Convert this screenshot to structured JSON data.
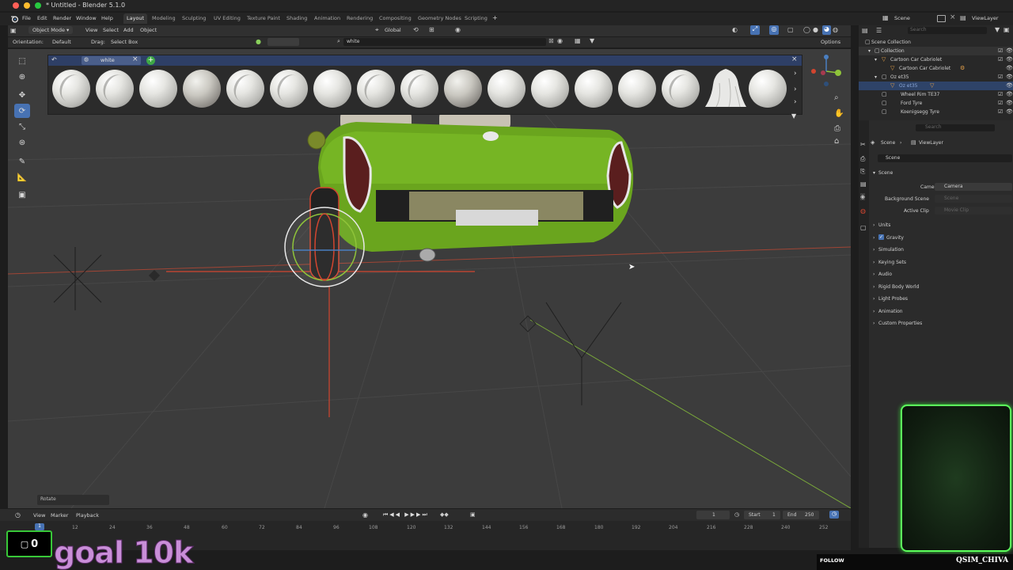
{
  "window": {
    "title": "* Untitled - Blender 5.1.0"
  },
  "menu": {
    "items": [
      "File",
      "Edit",
      "Render",
      "Window",
      "Help"
    ],
    "workspaces": [
      "Layout",
      "Modeling",
      "Sculpting",
      "UV Editing",
      "Texture Paint",
      "Shading",
      "Animation",
      "Rendering",
      "Compositing",
      "Geometry Nodes",
      "Scripting"
    ],
    "active_workspace": "Layout",
    "add_tab": "+",
    "scene_label": "Scene",
    "viewlayer_label": "ViewLayer"
  },
  "viewport_header": {
    "mode": "Object Mode",
    "menus": [
      "View",
      "Select",
      "Add",
      "Object"
    ],
    "transform": "Global"
  },
  "tool_settings": {
    "orientation_label": "Orientation:",
    "orientation_value": "Default",
    "drag_label": "Drag:",
    "drag_value": "Select Box",
    "search_value": "white",
    "options_label": "Options"
  },
  "asset_popup": {
    "tab_label": "white",
    "close": "×",
    "add": "+"
  },
  "last_operator": "Rotate",
  "outliner": {
    "search_placeholder": "Search",
    "rows": [
      {
        "label": "Scene Collection",
        "indent": 0
      },
      {
        "label": "Collection",
        "indent": 1
      },
      {
        "label": "Cartoon Car Cabriolet",
        "indent": 2
      },
      {
        "label": "Cartoon Car Cabriolet",
        "indent": 3
      },
      {
        "label": "Oz et35",
        "indent": 2
      },
      {
        "label": "Oz et35",
        "indent": 3
      },
      {
        "label": "Wheel Rim TE37",
        "indent": 2
      },
      {
        "label": "Ford Tyre",
        "indent": 2
      },
      {
        "label": "Koenigsegg Tyre",
        "indent": 2
      }
    ]
  },
  "properties": {
    "search_placeholder": "Search",
    "breadcrumb": [
      "Scene",
      "ViewLayer"
    ],
    "data_block": "Scene",
    "panel_scene": "Scene",
    "camera_label": "Camera",
    "camera_value": "Camera",
    "bg_scene_label": "Background Scene",
    "bg_scene_value": "Scene",
    "active_clip_label": "Active Clip",
    "active_clip_value": "Movie Clip",
    "panels": [
      "Units",
      "Gravity",
      "Simulation",
      "Keying Sets",
      "Audio",
      "Rigid Body World",
      "Light Probes",
      "Animation",
      "Custom Properties"
    ]
  },
  "timeline": {
    "menus": [
      "View",
      "Marker",
      "Playback"
    ],
    "current_frame": "1",
    "start_label": "Start",
    "start_value": "1",
    "end_label": "End",
    "end_value": "250",
    "ticks": [
      "12",
      "24",
      "36",
      "48",
      "60",
      "72",
      "84",
      "96",
      "108",
      "120",
      "132",
      "144",
      "156",
      "168",
      "180",
      "192",
      "204",
      "216",
      "228",
      "240",
      "252"
    ],
    "playhead": "1"
  },
  "overlay": {
    "counter": "0",
    "goal_text": "goal 10k",
    "follow_label": "FOLLOW",
    "channel_name": "QSIM_CHIVA"
  },
  "colors": {
    "accent_blue": "#4772b3",
    "car_green": "#6aa51e",
    "axis_red": "#d2452f",
    "axis_green": "#8fc43a",
    "webcam_border": "#5cff5c"
  }
}
